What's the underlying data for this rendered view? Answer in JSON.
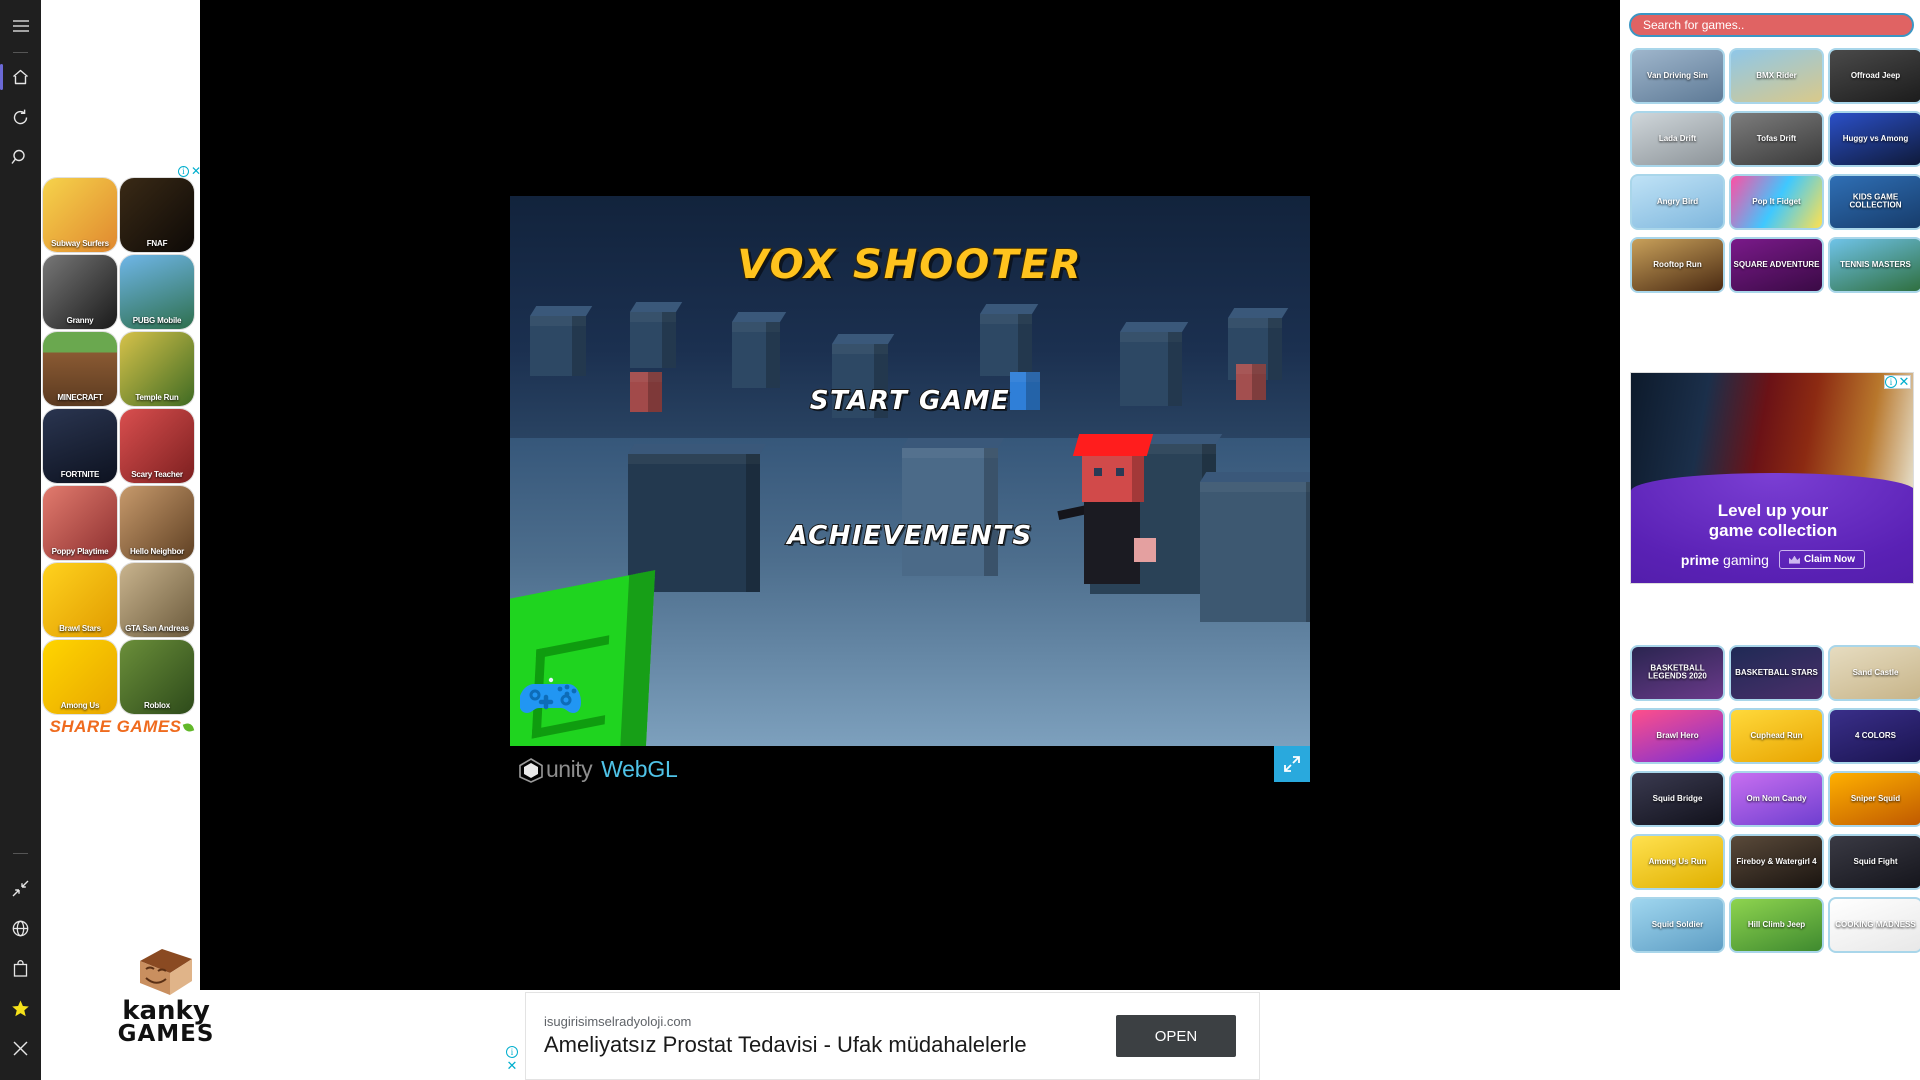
{
  "browser_rail": {
    "items": [
      {
        "name": "menu-icon",
        "label": "Menu"
      },
      {
        "name": "home-icon",
        "label": "Home",
        "active": true
      },
      {
        "name": "refresh-icon",
        "label": "Refresh"
      },
      {
        "name": "search-icon",
        "label": "Search"
      },
      {
        "name": "collapse-icon",
        "label": "Collapse"
      },
      {
        "name": "globe-icon",
        "label": "Browser"
      },
      {
        "name": "bag-icon",
        "label": "Shopping"
      },
      {
        "name": "star-icon",
        "label": "Favorites"
      },
      {
        "name": "close-icon",
        "label": "Close"
      }
    ],
    "accent_color": "#6b69d6",
    "background_color": "#1f1f1f",
    "star_color": "#f5e11a"
  },
  "left_ad": {
    "brand": "SHARE GAMES",
    "brand_color": "#ef6b1e",
    "badge_info": "i",
    "badge_close": "✕",
    "tiles": [
      {
        "label": "Subway Surfers",
        "bg": "linear-gradient(135deg,#f6d34b,#e0882f)"
      },
      {
        "label": "FNAF",
        "bg": "linear-gradient(135deg,#3a2a16,#0d0906)"
      },
      {
        "label": "Granny",
        "bg": "linear-gradient(135deg,#777,#1a1a1a)"
      },
      {
        "label": "PUBG Mobile",
        "bg": "linear-gradient(160deg,#6fb6e8,#2e6f4d)"
      },
      {
        "label": "MINECRAFT",
        "bg": "linear-gradient(180deg,#6aa84f 0%,#6aa84f 28%,#8a5a33 28%,#5b3a20 100%)"
      },
      {
        "label": "Temple Run",
        "bg": "linear-gradient(135deg,#d6c24a,#3f6b23)"
      },
      {
        "label": "FORTNITE",
        "bg": "linear-gradient(160deg,#2a3550,#0d1220)"
      },
      {
        "label": "Scary Teacher",
        "bg": "linear-gradient(135deg,#d94f4f,#7c1f1f)"
      },
      {
        "label": "Poppy Playtime",
        "bg": "linear-gradient(135deg,#e27b6e,#8c2f2f)"
      },
      {
        "label": "Hello Neighbor",
        "bg": "linear-gradient(135deg,#c79a6c,#5f4023)"
      },
      {
        "label": "Brawl Stars",
        "bg": "linear-gradient(135deg,#ffd21e,#e09b00)"
      },
      {
        "label": "GTA San Andreas",
        "bg": "linear-gradient(135deg,#c9b48e,#6b5a3c)"
      },
      {
        "label": "Among Us",
        "bg": "linear-gradient(135deg,#ffd500,#e8a600)"
      },
      {
        "label": "Roblox",
        "bg": "linear-gradient(135deg,#6b8f3a,#2d4a1a)"
      }
    ]
  },
  "game": {
    "title": "VOX SHOOTER",
    "title_color": "#ffc31e",
    "menu": [
      {
        "label": "START GAME"
      },
      {
        "label": "ACHIEVEMENTS"
      }
    ],
    "player_engine": {
      "brand": "unity",
      "platform": "WebGL",
      "brand_color": "#8e8e8e",
      "platform_color": "#4fc3e8"
    },
    "fullscreen_label": "Fullscreen",
    "fullscreen_color": "#29a9dd",
    "gamepad_icon_color": "#2196f3"
  },
  "right_sidebar": {
    "search": {
      "placeholder": "Search for games..",
      "value": "",
      "bg_color": "#e06363",
      "border_color": "#3b96c4"
    },
    "top_games": [
      {
        "label": "Van Driving Sim",
        "bg": "linear-gradient(160deg,#9fb6cc,#5e7a96)"
      },
      {
        "label": "BMX Rider",
        "bg": "linear-gradient(160deg,#8fc7e8,#d9c98a)"
      },
      {
        "label": "Offroad Jeep",
        "bg": "linear-gradient(160deg,#4a4a4a,#1c1c1c)"
      },
      {
        "label": "Lada Drift",
        "bg": "linear-gradient(160deg,#cfd6da,#8d9499)"
      },
      {
        "label": "Tofas Drift",
        "bg": "linear-gradient(160deg,#7d7d7d,#3a3a3a)"
      },
      {
        "label": "Huggy vs Among",
        "bg": "linear-gradient(160deg,#2b50c8,#0f1a3a)"
      },
      {
        "label": "Angry Bird",
        "bg": "linear-gradient(160deg,#bfe2f6,#7fb7dd)"
      },
      {
        "label": "Pop It Fidget",
        "bg": "linear-gradient(120deg,#ff4fa3,#3fc8ff,#ffe14f)"
      },
      {
        "label": "KIDS GAME COLLECTION",
        "bg": "linear-gradient(160deg,#2f6fb5,#173c6b)"
      },
      {
        "label": "Rooftop Run",
        "bg": "linear-gradient(160deg,#c8a05a,#4a2a12)"
      },
      {
        "label": "SQUARE ADVENTURE",
        "bg": "linear-gradient(160deg,#7a1a8a,#3a0a45)"
      },
      {
        "label": "TENNIS MASTERS",
        "bg": "linear-gradient(160deg,#6fc3e8,#2f6f3f)"
      }
    ],
    "bottom_games": [
      {
        "label": "BASKETBALL LEGENDS 2020",
        "bg": "linear-gradient(160deg,#2a2550,#6a3a8a)"
      },
      {
        "label": "BASKETBALL STARS",
        "bg": "linear-gradient(160deg,#1f2a55,#4a2f6a)"
      },
      {
        "label": "Sand Castle",
        "bg": "linear-gradient(160deg,#e6dcc0,#c7b489)"
      },
      {
        "label": "Brawl Hero",
        "bg": "linear-gradient(160deg,#ff4f8a,#7a2fd4)"
      },
      {
        "label": "Cuphead Run",
        "bg": "linear-gradient(160deg,#ffd93b,#e8a400)"
      },
      {
        "label": "4 COLORS",
        "bg": "linear-gradient(160deg,#3a2f8a,#1a1450)"
      },
      {
        "label": "Squid Bridge",
        "bg": "linear-gradient(160deg,#3a3a50,#12121c)"
      },
      {
        "label": "Om Nom Candy",
        "bg": "linear-gradient(160deg,#c86ff0,#6f3fd0)"
      },
      {
        "label": "Sniper Squid",
        "bg": "linear-gradient(160deg,#ffb000,#c05a00)"
      },
      {
        "label": "Among Us Run",
        "bg": "linear-gradient(160deg,#ffe14f,#e0b000)"
      },
      {
        "label": "Fireboy & Watergirl 4",
        "bg": "linear-gradient(160deg,#5a4a3a,#1a1410)"
      },
      {
        "label": "Squid Fight",
        "bg": "linear-gradient(160deg,#3a3a44,#15151c)"
      },
      {
        "label": "Squid Soldier",
        "bg": "linear-gradient(160deg,#9fd6ef,#5f9ec4)"
      },
      {
        "label": "Hill Climb Jeep",
        "bg": "linear-gradient(160deg,#8ed44f,#3f8a2f)"
      },
      {
        "label": "COOKING MADNESS",
        "bg": "linear-gradient(160deg,#ffffff,#e8e8e8)"
      }
    ],
    "prime_ad": {
      "headline_line1": "Level up your",
      "headline_line2": "game collection",
      "brand_bold": "prime",
      "brand_light": "gaming",
      "cta": "Claim Now",
      "badge_info": "i",
      "badge_close": "✕",
      "accent_color": "#5a21b5"
    }
  },
  "bottom_ad": {
    "domain": "isugirisimselradyoloji.com",
    "headline": "Ameliyatsız Prostat Tedavisi - Ufak müdahalelerle",
    "cta": "OPEN",
    "badge_info": "i",
    "badge_close": "✕"
  },
  "site_logo": {
    "line1": "kanky",
    "line2": "GAMES"
  }
}
